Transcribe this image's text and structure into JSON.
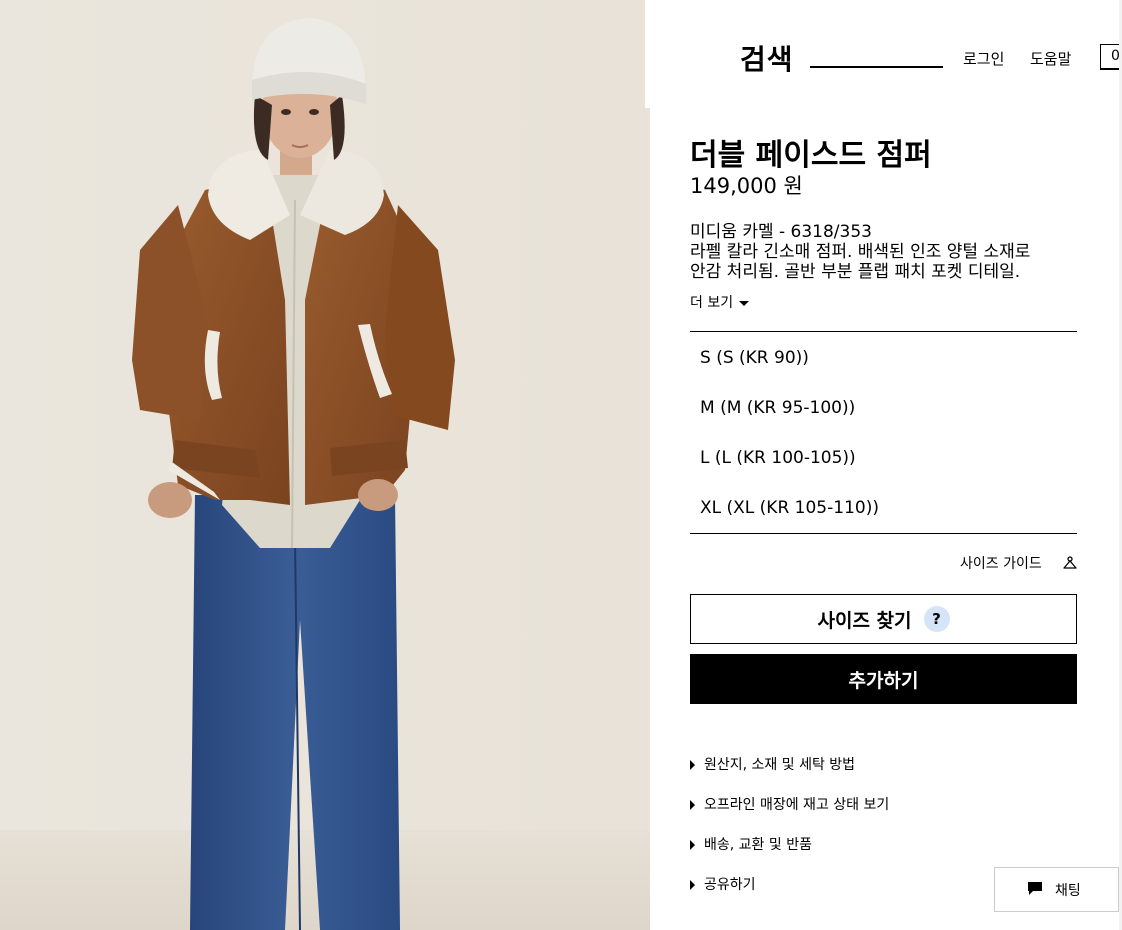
{
  "header": {
    "search_label": "검색",
    "login": "로그인",
    "help": "도움말",
    "cart_count": "0"
  },
  "product": {
    "name": "더블 페이스드 점퍼",
    "price": "149,000 원",
    "color_ref": "미디움 카멜 - 6318/353",
    "description_line1": "라펠 칼라 긴소매 점퍼. 배색된 인조 양털 소재로",
    "description_line2": "안감 처리됨. 골반 부분 플랩 패치 포켓 디테일.",
    "more_label": "더 보기"
  },
  "sizes": [
    {
      "label": "S (S (KR 90))"
    },
    {
      "label": "M (M (KR 95-100))"
    },
    {
      "label": "L (L (KR 100-105))"
    },
    {
      "label": "XL (XL (KR 105-110))"
    }
  ],
  "size_guide": "사이즈 가이드",
  "find_size_label": "사이즈 찾기",
  "find_size_help": "?",
  "add_label": "추가하기",
  "info_links": [
    "원산지, 소재 및 세탁 방법",
    "오프라인 매장에 재고 상태 보기",
    "배송, 교환 및 반품",
    "공유하기"
  ],
  "chat_label": "채팅",
  "icons": {
    "cart": "cart-icon",
    "hanger": "hanger-icon",
    "chat": "chat-icon",
    "caret": "caret-down-icon"
  },
  "colors": {
    "photo_background": "#e9e4db",
    "jacket": "#8b5128",
    "shearling": "#eeeae2",
    "jeans": "#2e4f87",
    "beanie": "#ecebe6",
    "add_button": "#000000",
    "help_badge": "#d6e4f8"
  }
}
